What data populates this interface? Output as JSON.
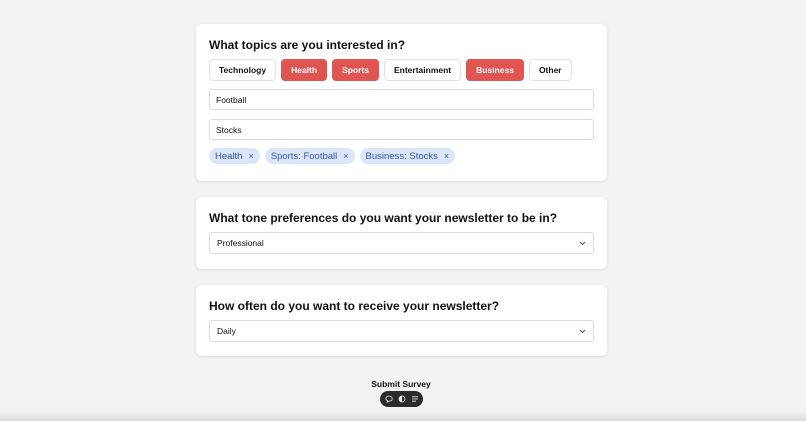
{
  "theme": {
    "accent": "#e05452",
    "tag_bg": "#dce6f8",
    "tag_text": "#2f5aa8"
  },
  "topics": {
    "question": "What topics are you interested in?",
    "chips": [
      {
        "label": "Technology",
        "selected": false
      },
      {
        "label": "Health",
        "selected": true
      },
      {
        "label": "Sports",
        "selected": true
      },
      {
        "label": "Entertainment",
        "selected": false
      },
      {
        "label": "Business",
        "selected": true
      },
      {
        "label": "Other",
        "selected": false
      }
    ],
    "sports_input_value": "Football",
    "business_input_value": "Stocks",
    "tags": [
      "Health",
      "Sports: Football",
      "Business: Stocks"
    ],
    "tag_remove_glyph": "×"
  },
  "tone": {
    "question": "What tone preferences do you want your newsletter to be in?",
    "selected": "Professional"
  },
  "frequency": {
    "question": "How often do you want to receive your newsletter?",
    "selected": "Daily"
  },
  "submit_label": "Submit Survey",
  "toolbar": {
    "icons": [
      "comment-icon",
      "toggle-icon",
      "list-icon"
    ]
  }
}
